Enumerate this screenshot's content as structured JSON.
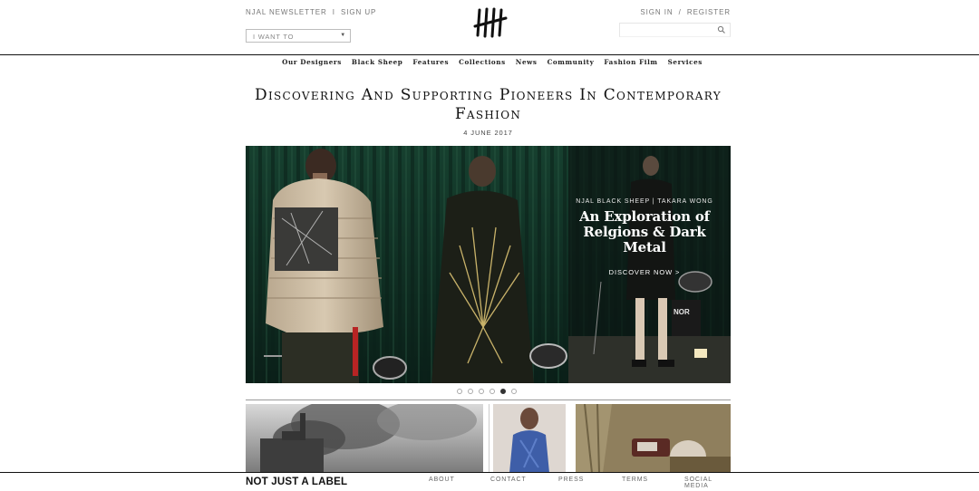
{
  "header": {
    "newsletter_label": "NJAL NEWSLETTER",
    "separator": "I",
    "signup_label": "SIGN UP",
    "want_select_value": "I WANT TO",
    "signin_label": "SIGN IN",
    "register_label": "REGISTER",
    "auth_separator": "/",
    "search_placeholder": ""
  },
  "nav": {
    "items": [
      "Our Designers",
      "Black Sheep",
      "Features",
      "Collections",
      "News",
      "Community",
      "Fashion Film",
      "Services"
    ]
  },
  "article": {
    "headline": "Discovering And Supporting Pioneers In Contemporary Fashion",
    "date": "4 JUNE 2017"
  },
  "hero": {
    "kicker": "NJAL BLACK SHEEP | TAKARA WONG",
    "title": "An Exploration of Relgions & Dark Metal",
    "cta": "DISCOVER NOW >",
    "kick_drum_text": "NOR"
  },
  "slider": {
    "dot_count": 6,
    "active_index": 4
  },
  "footer": {
    "brand": "NOT JUST A LABEL",
    "links": [
      "ABOUT",
      "CONTACT",
      "PRESS",
      "TERMS"
    ],
    "social_label": "SOCIAL MEDIA"
  },
  "colors": {
    "curtain": "#123528",
    "accent_black": "#111111",
    "muted_text": "#777777"
  }
}
